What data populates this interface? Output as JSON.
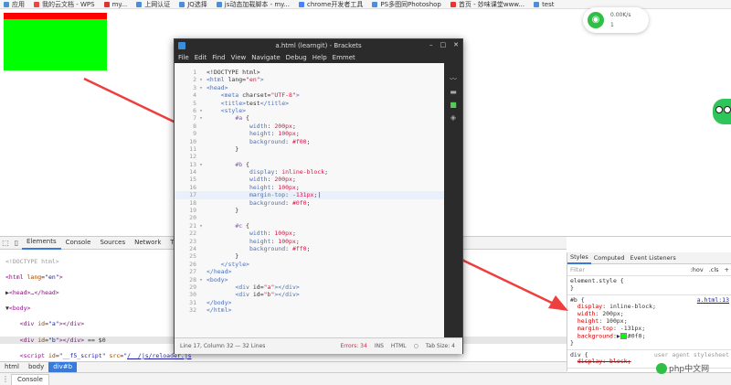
{
  "bookmarks": [
    {
      "label": "应用"
    },
    {
      "label": "我的云文档 - WPS"
    },
    {
      "label": "my..."
    },
    {
      "label": "上网认证"
    },
    {
      "label": "JQ选择"
    },
    {
      "label": "js动态加载脚本 - my..."
    },
    {
      "label": "chrome开发者工具"
    },
    {
      "label": "PS多图同Photoshop"
    },
    {
      "label": "首页 - 妙味课堂www..."
    },
    {
      "label": "test"
    }
  ],
  "network": {
    "speed": "0.00K/s",
    "count": "1"
  },
  "brackets": {
    "title": "a.html (learngit) - Brackets",
    "menu": [
      "File",
      "Edit",
      "Find",
      "View",
      "Navigate",
      "Debug",
      "Help",
      "Emmet"
    ],
    "status": {
      "position": "Line 17, Column 32 — 32 Lines",
      "errors": "Errors: 34",
      "ins": "INS",
      "mode": "HTML",
      "tabsize": "Tab Size: 4"
    }
  },
  "devtools": {
    "tabs": [
      "Elements",
      "Console",
      "Sources",
      "Network",
      "Tim"
    ],
    "breadcrumbs": [
      "html",
      "body",
      "div#b"
    ],
    "console_tab": "Console",
    "styles_tabs": [
      "Styles",
      "Computed",
      "Event Listeners"
    ],
    "filter_placeholder": "Filter",
    "hov": ":hov",
    "cls": ".cls",
    "plus": "+",
    "element_style": "element.style {",
    "rule_selector": "#b {",
    "rule_source": "a.html:13",
    "rule_props": [
      {
        "name": "display",
        "value": "inline-block;"
      },
      {
        "name": "width",
        "value": "200px;"
      },
      {
        "name": "height",
        "value": "100px;"
      },
      {
        "name": "margin-top",
        "value": "-131px;"
      },
      {
        "name": "background",
        "value": "#0f0;"
      }
    ],
    "ua_selector": "div {",
    "ua_source": "user agent stylesheet",
    "ua_prop": "display: block;"
  },
  "watermark": "php中文网",
  "colors": {
    "red": "#ff0000",
    "green": "#00ff00",
    "arrow": "#ef3e3e"
  }
}
